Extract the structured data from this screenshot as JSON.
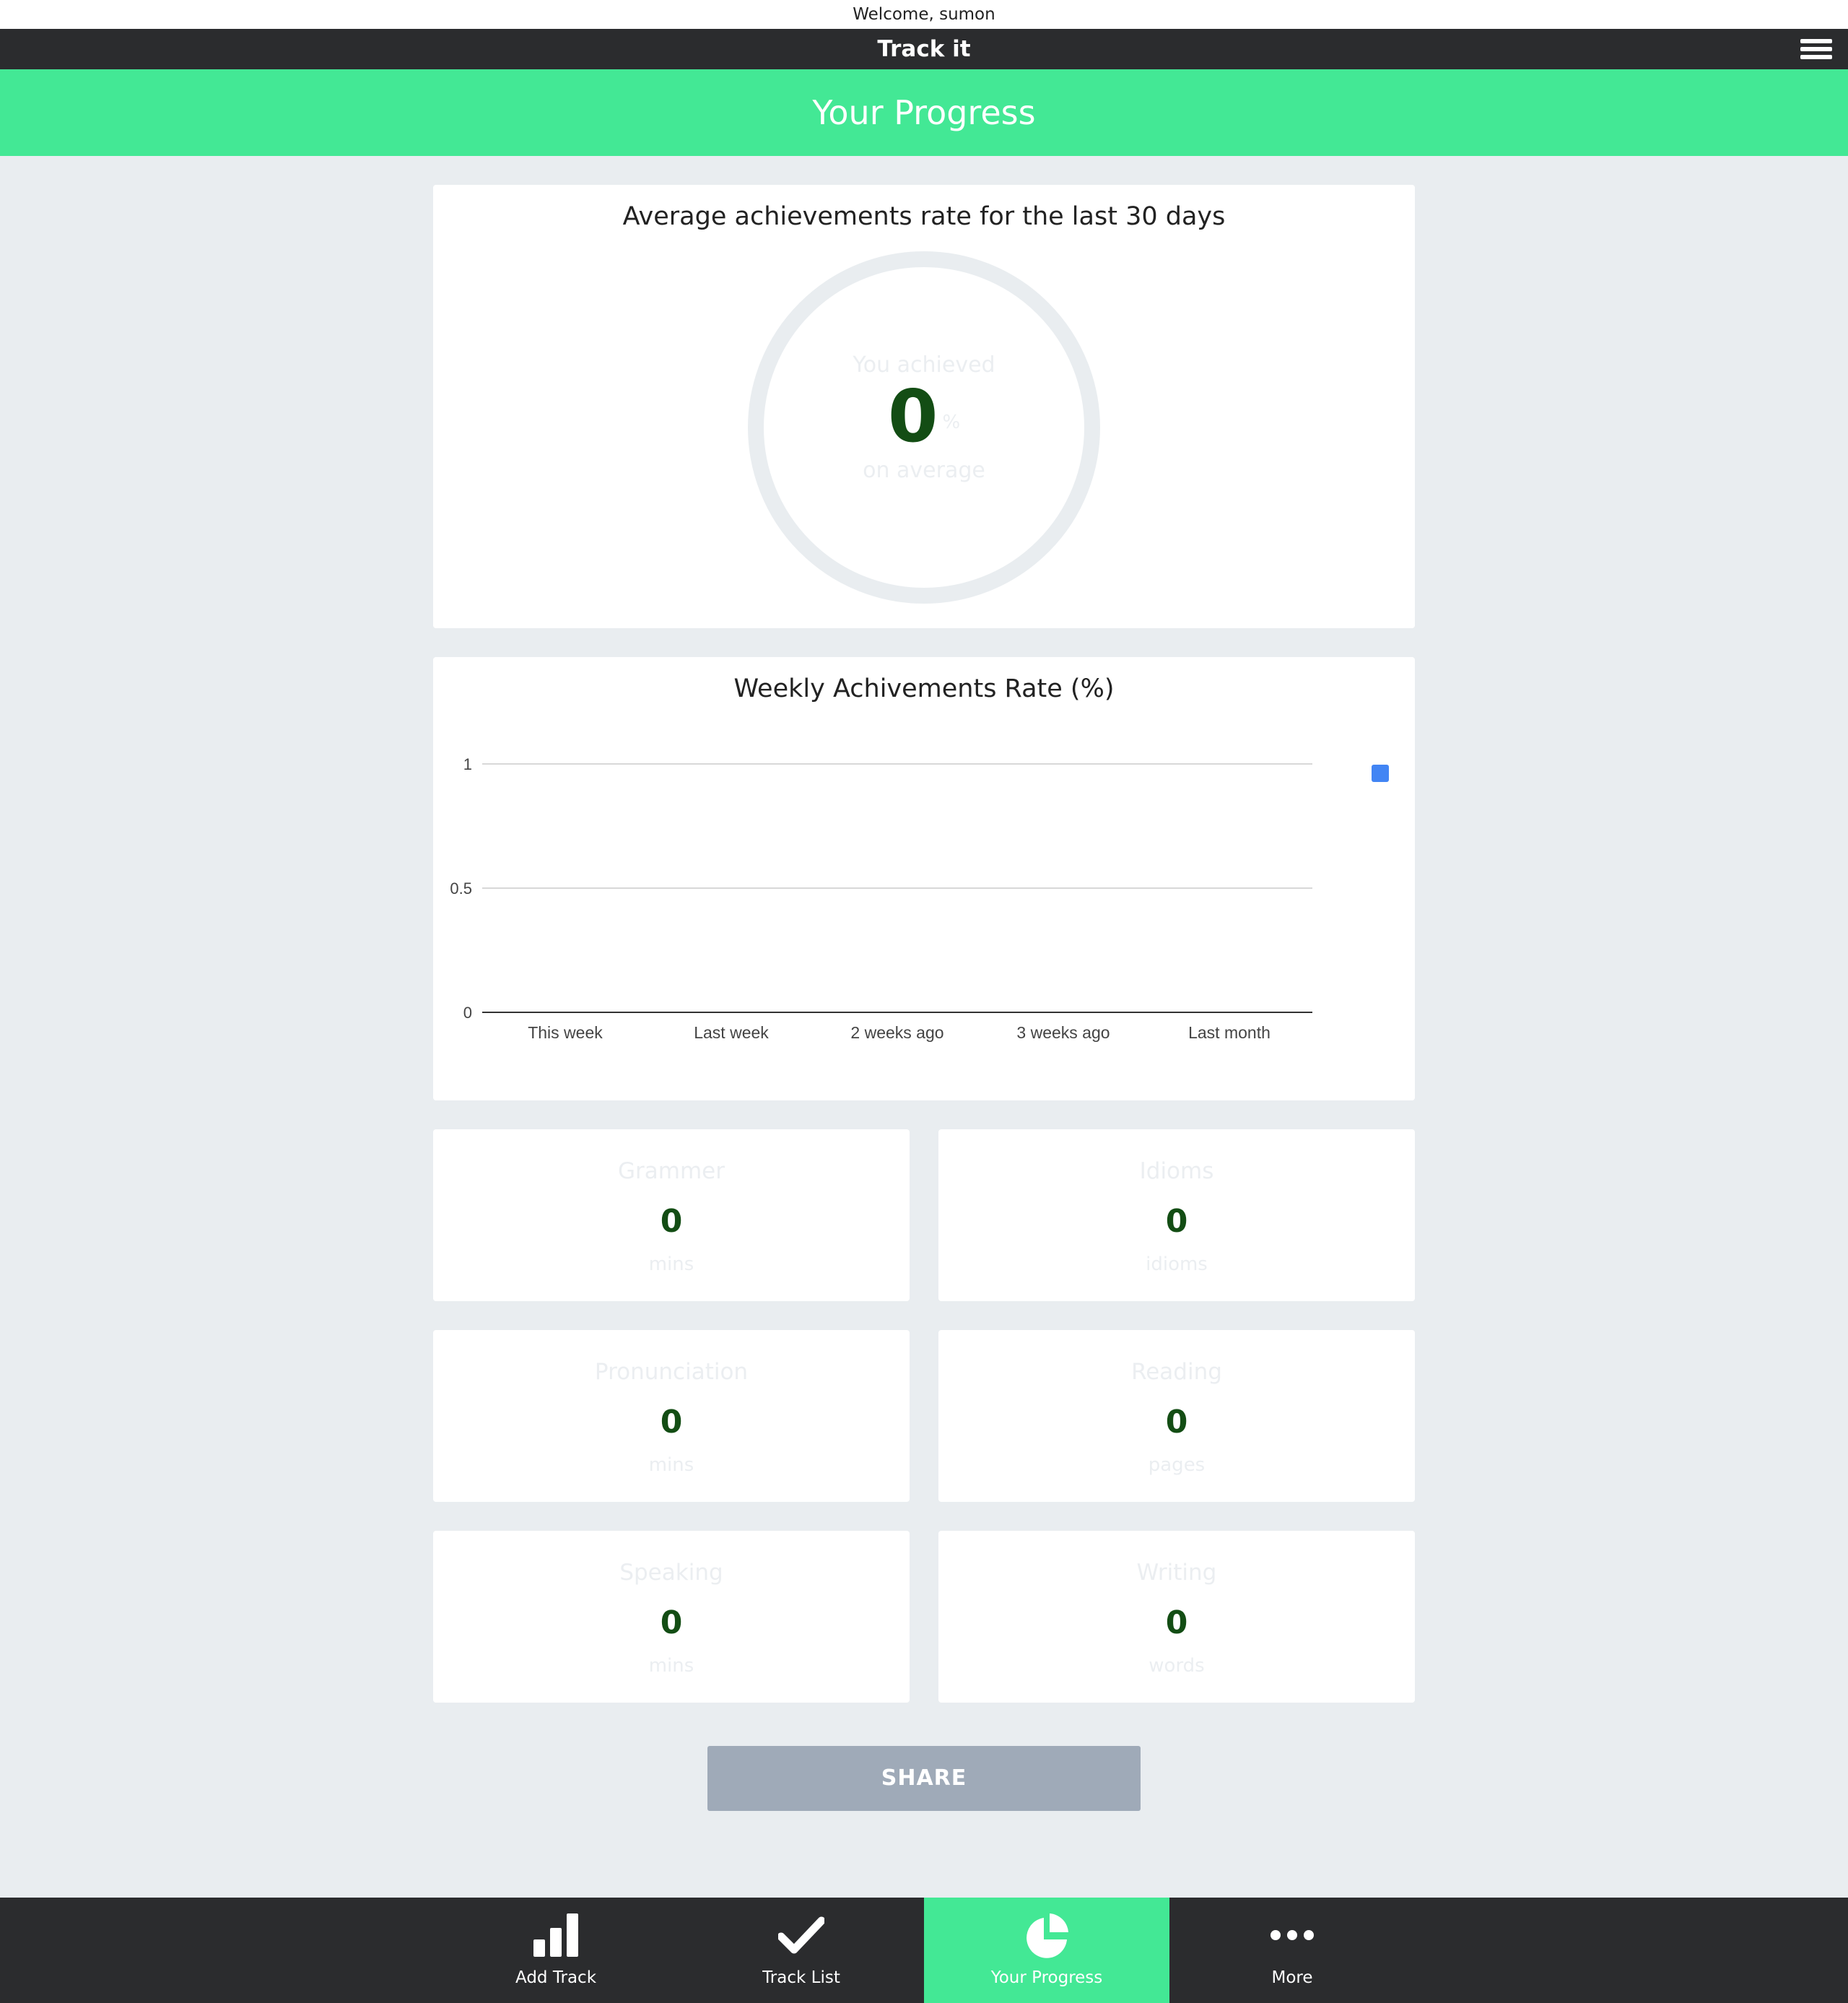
{
  "welcome_text": "Welcome, sumon",
  "app_title": "Track it",
  "page_title": "Your Progress",
  "icons": {
    "menu": "hamburger-menu-icon",
    "add_track": "bar-chart-icon",
    "track_list": "checkmark-icon",
    "your_progress": "pie-chart-icon",
    "more": "more-dots-icon"
  },
  "colors": {
    "accent": "#43e895",
    "dark": "#2b2c2e",
    "value_green": "#134d14",
    "legend_blue": "#4285f4",
    "share_button": "#9faab8"
  },
  "average_card": {
    "title": "Average achievements rate for the last 30 days",
    "top_text": "You achieved",
    "value": "0",
    "unit": "%",
    "bottom_text": "on average"
  },
  "weekly_card": {
    "title": "Weekly Achivements Rate (%)"
  },
  "chart_data": {
    "type": "bar",
    "title": "Weekly Achivements Rate (%)",
    "categories": [
      "This week",
      "Last week",
      "2 weeks ago",
      "3 weeks ago",
      "Last month"
    ],
    "values": [
      0,
      0,
      0,
      0,
      0
    ],
    "ylim": [
      0,
      1
    ],
    "yticks": [
      "0",
      "0.5",
      "1"
    ],
    "grid": true,
    "legend": "right",
    "series_color": "#4285f4"
  },
  "stats": [
    {
      "label": "Grammer",
      "value": "0",
      "unit": "mins"
    },
    {
      "label": "Idioms",
      "value": "0",
      "unit": "idioms"
    },
    {
      "label": "Pronunciation",
      "value": "0",
      "unit": "mins"
    },
    {
      "label": "Reading",
      "value": "0",
      "unit": "pages"
    },
    {
      "label": "Speaking",
      "value": "0",
      "unit": "mins"
    },
    {
      "label": "Writing",
      "value": "0",
      "unit": "words"
    }
  ],
  "share_label": "SHARE",
  "nav": [
    {
      "label": "Add Track",
      "active": false
    },
    {
      "label": "Track List",
      "active": false
    },
    {
      "label": "Your Progress",
      "active": true
    },
    {
      "label": "More",
      "active": false
    }
  ]
}
